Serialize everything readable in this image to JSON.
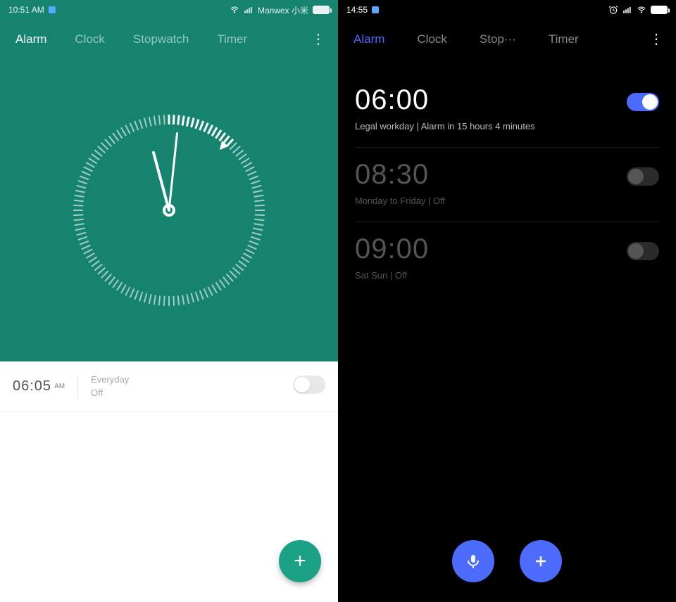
{
  "left": {
    "statusbar": {
      "time": "10:51 AM",
      "carrier": "Manwex 小米"
    },
    "tabs": {
      "items": [
        "Alarm",
        "Clock",
        "Stopwatch",
        "Timer"
      ],
      "activeIndex": 0
    },
    "alarm": {
      "time": "06:05",
      "ampm": "AM",
      "repeat": "Everyday",
      "status": "Off",
      "enabled": false
    },
    "fab": {
      "add_label": "+"
    }
  },
  "right": {
    "statusbar": {
      "time": "14:55"
    },
    "tabs": {
      "items": [
        "Alarm",
        "Clock",
        "Stop···",
        "Timer"
      ],
      "activeIndex": 0
    },
    "alarms": [
      {
        "time": "06:00",
        "desc": "Legal workday  |  Alarm in 15 hours 4 minutes",
        "enabled": true
      },
      {
        "time": "08:30",
        "desc": "Monday to Friday  |  Off",
        "enabled": false
      },
      {
        "time": "09:00",
        "desc": "Sat Sun  |  Off",
        "enabled": false
      }
    ]
  },
  "icons": {
    "wifi": "wifi-icon",
    "signal": "signal-icon",
    "battery": "battery-icon",
    "alarm": "alarm-icon",
    "mic": "mic-icon",
    "plus": "plus-icon",
    "more": "more-icon"
  }
}
